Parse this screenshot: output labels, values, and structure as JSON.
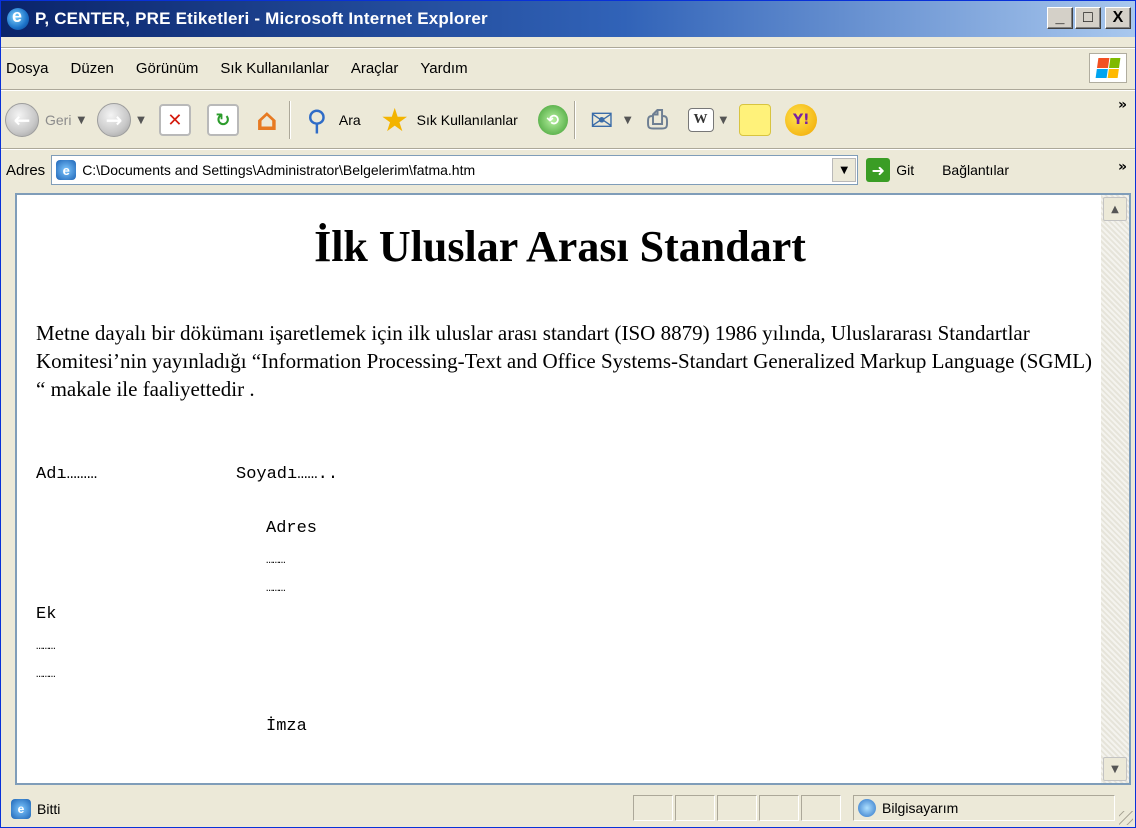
{
  "window": {
    "title": "P, CENTER, PRE Etiketleri - Microsoft Internet Explorer",
    "minimize": "_",
    "maximize": "□",
    "close": "X"
  },
  "menu": [
    "Dosya",
    "Düzen",
    "Görünüm",
    "Sık Kullanılanlar",
    "Araçlar",
    "Yardım"
  ],
  "toolbar": {
    "back_label": "Geri",
    "search_label": "Ara",
    "favorites_label": "Sık Kullanılanlar",
    "overflow": "»"
  },
  "address": {
    "label": "Adres",
    "value": "C:\\Documents and Settings\\Administrator\\Belgelerim\\fatma.htm",
    "go_label": "Git",
    "links_label": "Bağlantılar",
    "links_overflow": "»"
  },
  "document": {
    "heading": "İlk Uluslar Arası Standart",
    "paragraph": "Metne dayalı bir dökümanı işaretlemek için ilk uluslar arası standart (ISO 8879) 1986 yılında, Uluslararası Standartlar Komitesi’nin yayınladığı “Information Processing-Text and Office Systems-Standart Generalized Markup Language (SGML) “ makale ile faaliyettedir .",
    "pre": {
      "name": "Adı………",
      "surname": "Soyadı……..",
      "address_label": "Adres",
      "address_dots_1": "………",
      "address_dots_2": "………",
      "ek_label": "Ek",
      "ek_dots_1": "………",
      "ek_dots_2": "………",
      "signature_label": "İmza"
    }
  },
  "status": {
    "text": "Bitti",
    "zone": "Bilgisayarım"
  }
}
